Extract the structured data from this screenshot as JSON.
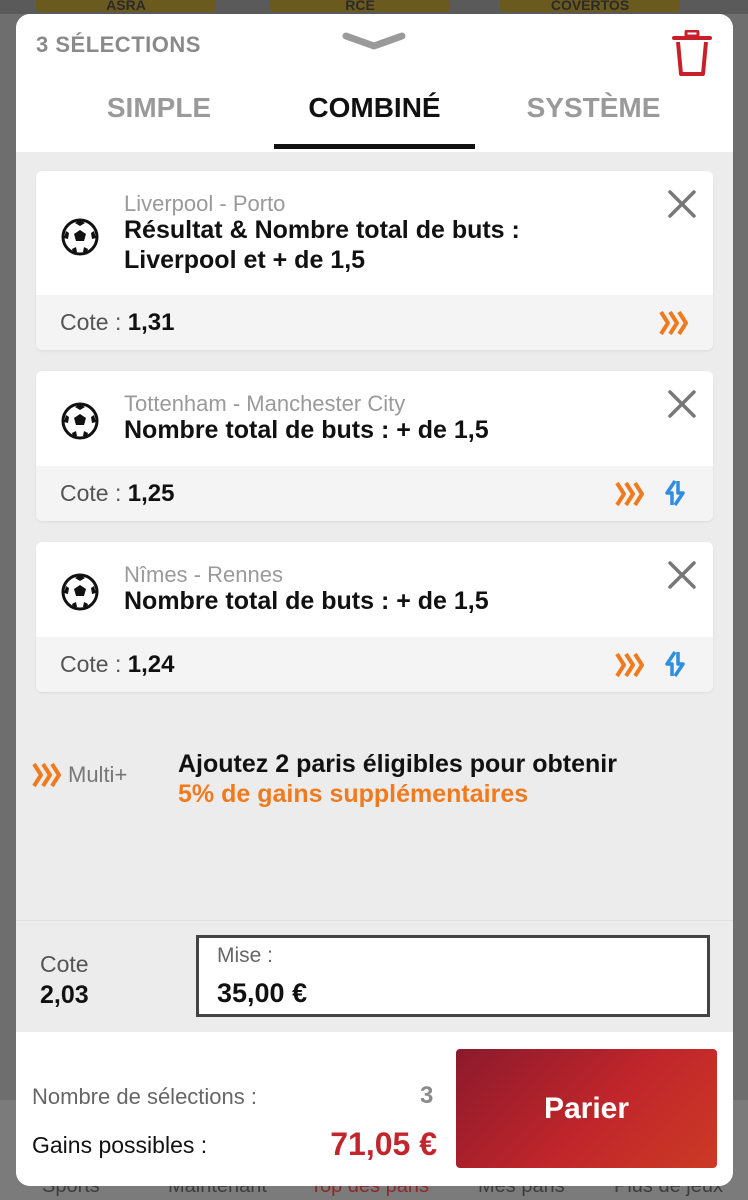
{
  "background": {
    "top_buttons": [
      "ASRA",
      "RCE",
      "COVERTOS"
    ],
    "nav_items": [
      "Sports",
      "Maintenant",
      "Top des paris",
      "Mes paris",
      "Plus de jeux"
    ]
  },
  "header": {
    "selection_count": "3 SÉLECTIONS",
    "tabs": [
      {
        "label": "SIMPLE",
        "active": false
      },
      {
        "label": "COMBINÉ",
        "active": true
      },
      {
        "label": "SYSTÈME",
        "active": false
      }
    ]
  },
  "selections": [
    {
      "match": "Liverpool - Porto",
      "market_line1": "Résultat & Nombre total de buts :",
      "market_line2": "Liverpool et + de 1,5",
      "cote_label": "Cote :",
      "cote": "1,31",
      "icons": [
        "boost-icon"
      ]
    },
    {
      "match": "Tottenham - Manchester City",
      "market_line1": "Nombre total de buts : + de 1,5",
      "market_line2": "",
      "cote_label": "Cote :",
      "cote": "1,25",
      "icons": [
        "boost-icon",
        "swap-icon"
      ]
    },
    {
      "match": "Nîmes - Rennes",
      "market_line1": "Nombre total de buts : + de 1,5",
      "market_line2": "",
      "cote_label": "Cote :",
      "cote": "1,24",
      "icons": [
        "boost-icon",
        "swap-icon"
      ]
    }
  ],
  "multi": {
    "label": "Multi+",
    "title": "Ajoutez 2 paris éligibles pour obtenir",
    "subtitle": "5% de gains supplémentaires"
  },
  "summary": {
    "cote_label": "Cote",
    "cote_value": "2,03",
    "stake_label": "Mise :",
    "stake_value": "35,00 €",
    "nb_selections_label": "Nombre de sélections :",
    "nb_selections_value": "3",
    "gains_label": "Gains possibles :",
    "gains_value": "71,05 €",
    "bet_button": "Parier"
  },
  "colors": {
    "accent_orange": "#f07b1f",
    "swap_blue": "#2e8fe0",
    "bet_red": "#c0262b",
    "trash_red": "#c8202a"
  }
}
